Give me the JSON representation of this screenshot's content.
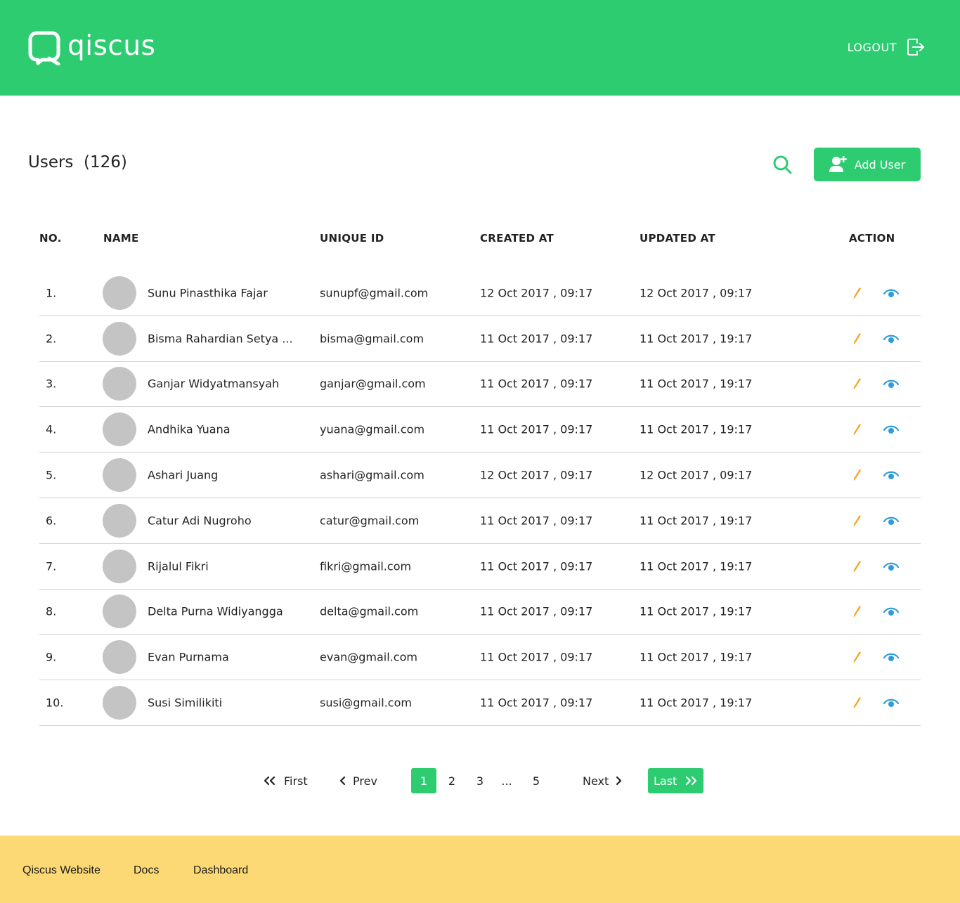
{
  "header": {
    "logo_text": "qiscus",
    "logout_label": "LOGOUT"
  },
  "page": {
    "title": "Users",
    "count": "(126)"
  },
  "toolbar": {
    "add_user_label": "Add User"
  },
  "table": {
    "columns": [
      "NO.",
      "NAME",
      "UNIQUE ID",
      "CREATED AT",
      "UPDATED AT",
      "ACTION"
    ],
    "rows": [
      {
        "no": "1.",
        "name": "Sunu Pinasthika Fajar",
        "unique_id": "sunupf@gmail.com",
        "created_at": "12 Oct 2017 , 09:17",
        "updated_at": "12 Oct 2017 , 09:17"
      },
      {
        "no": "2.",
        "name": "Bisma Rahardian Setya ...",
        "unique_id": "bisma@gmail.com",
        "created_at": "11 Oct 2017 , 09:17",
        "updated_at": "11 Oct 2017 , 19:17"
      },
      {
        "no": "3.",
        "name": "Ganjar Widyatmansyah",
        "unique_id": "ganjar@gmail.com",
        "created_at": "11 Oct 2017 , 09:17",
        "updated_at": "11 Oct 2017 , 19:17"
      },
      {
        "no": "4.",
        "name": "Andhika Yuana",
        "unique_id": "yuana@gmail.com",
        "created_at": "11 Oct 2017 , 09:17",
        "updated_at": "11 Oct 2017 , 19:17"
      },
      {
        "no": "5.",
        "name": "Ashari Juang",
        "unique_id": "ashari@gmail.com",
        "created_at": "12 Oct 2017 , 09:17",
        "updated_at": "12 Oct 2017 , 09:17"
      },
      {
        "no": "6.",
        "name": "Catur Adi Nugroho",
        "unique_id": "catur@gmail.com",
        "created_at": "11 Oct 2017 , 09:17",
        "updated_at": "11 Oct 2017 , 19:17"
      },
      {
        "no": "7.",
        "name": "Rijalul Fikri",
        "unique_id": "fikri@gmail.com",
        "created_at": "11 Oct 2017 , 09:17",
        "updated_at": "11 Oct 2017 , 19:17"
      },
      {
        "no": "8.",
        "name": "Delta Purna Widiyangga",
        "unique_id": "delta@gmail.com",
        "created_at": "11 Oct 2017 , 09:17",
        "updated_at": "11 Oct 2017 , 19:17"
      },
      {
        "no": "9.",
        "name": "Evan Purnama",
        "unique_id": "evan@gmail.com",
        "created_at": "11 Oct 2017 , 09:17",
        "updated_at": "11 Oct 2017 , 19:17"
      },
      {
        "no": "10.",
        "name": "Susi Similikiti",
        "unique_id": "susi@gmail.com",
        "created_at": "11 Oct 2017 , 09:17",
        "updated_at": "11 Oct 2017 , 19:17"
      }
    ]
  },
  "pagination": {
    "first_label": "First",
    "prev_label": "Prev",
    "pages": [
      "1",
      "2",
      "3",
      "...",
      "5"
    ],
    "current_page": "1",
    "next_label": "Next",
    "last_label": "Last"
  },
  "footer": {
    "links": [
      "Qiscus Website",
      "Docs",
      "Dashboard"
    ]
  },
  "colors": {
    "brand_green": "#2ecc71",
    "footer_yellow": "#fcd975",
    "edit_orange": "#f5a623",
    "view_blue": "#2d9cdb",
    "avatar_gray": "#c4c4c4"
  },
  "icons": {
    "logo": "qiscus-logo-icon",
    "logout": "logout-icon",
    "search": "search-icon",
    "add_user": "add-user-icon",
    "edit": "pencil-icon",
    "view": "eye-icon",
    "first": "double-chevron-left-icon",
    "prev": "chevron-left-icon",
    "next": "chevron-right-icon",
    "last": "double-chevron-right-icon"
  }
}
